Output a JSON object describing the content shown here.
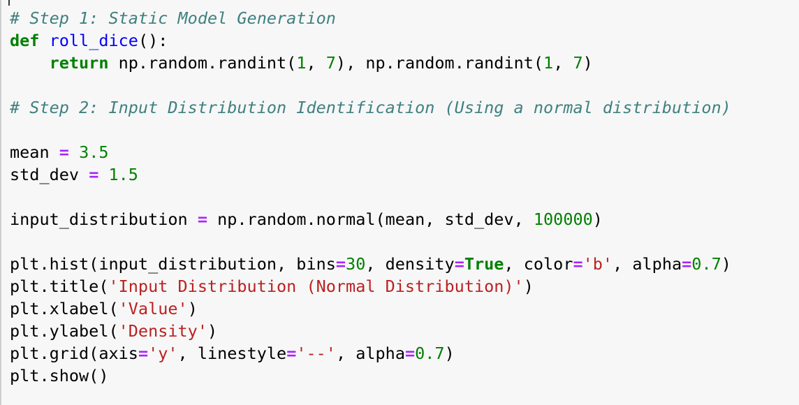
{
  "code": {
    "lines": [
      [
        {
          "t": "# Step 1: Static Model Generation",
          "k": "cm"
        }
      ],
      [
        {
          "t": "def",
          "k": "kw"
        },
        {
          "t": " "
        },
        {
          "t": "roll_dice",
          "k": "fn"
        },
        {
          "t": "():"
        }
      ],
      [
        {
          "t": "    "
        },
        {
          "t": "return",
          "k": "kw"
        },
        {
          "t": " np.random.randint("
        },
        {
          "t": "1",
          "k": "num"
        },
        {
          "t": ", "
        },
        {
          "t": "7",
          "k": "num"
        },
        {
          "t": "), np.random.randint("
        },
        {
          "t": "1",
          "k": "num"
        },
        {
          "t": ", "
        },
        {
          "t": "7",
          "k": "num"
        },
        {
          "t": ")"
        }
      ],
      [],
      [
        {
          "t": "# Step 2: Input Distribution Identification (Using a normal distribution)",
          "k": "cm"
        }
      ],
      [],
      [
        {
          "t": "mean "
        },
        {
          "t": "=",
          "k": "op"
        },
        {
          "t": " "
        },
        {
          "t": "3.5",
          "k": "num"
        }
      ],
      [
        {
          "t": "std_dev "
        },
        {
          "t": "=",
          "k": "op"
        },
        {
          "t": " "
        },
        {
          "t": "1.5",
          "k": "num"
        }
      ],
      [],
      [
        {
          "t": "input_distribution "
        },
        {
          "t": "=",
          "k": "op"
        },
        {
          "t": " np.random.normal(mean, std_dev, "
        },
        {
          "t": "100000",
          "k": "num"
        },
        {
          "t": ")"
        }
      ],
      [],
      [
        {
          "t": "plt.hist(input_distribution, bins"
        },
        {
          "t": "=",
          "k": "op"
        },
        {
          "t": "30",
          "k": "num"
        },
        {
          "t": ", density"
        },
        {
          "t": "=",
          "k": "op"
        },
        {
          "t": "True",
          "k": "bool"
        },
        {
          "t": ", color"
        },
        {
          "t": "=",
          "k": "op"
        },
        {
          "t": "'b'",
          "k": "str"
        },
        {
          "t": ", alpha"
        },
        {
          "t": "=",
          "k": "op"
        },
        {
          "t": "0.7",
          "k": "num"
        },
        {
          "t": ")"
        }
      ],
      [
        {
          "t": "plt.title("
        },
        {
          "t": "'Input Distribution (Normal Distribution)'",
          "k": "str"
        },
        {
          "t": ")"
        }
      ],
      [
        {
          "t": "plt.xlabel("
        },
        {
          "t": "'Value'",
          "k": "str"
        },
        {
          "t": ")"
        }
      ],
      [
        {
          "t": "plt.ylabel("
        },
        {
          "t": "'Density'",
          "k": "str"
        },
        {
          "t": ")"
        }
      ],
      [
        {
          "t": "plt.grid(axis"
        },
        {
          "t": "=",
          "k": "op"
        },
        {
          "t": "'y'",
          "k": "str"
        },
        {
          "t": ", linestyle"
        },
        {
          "t": "=",
          "k": "op"
        },
        {
          "t": "'--'",
          "k": "str"
        },
        {
          "t": ", alpha"
        },
        {
          "t": "=",
          "k": "op"
        },
        {
          "t": "0.7",
          "k": "num"
        },
        {
          "t": ")"
        }
      ],
      [
        {
          "t": "plt.show()"
        }
      ]
    ]
  },
  "colors": {
    "cell_background": "#f7f7f7",
    "comment": "#408080",
    "keyword": "#008000",
    "function_name": "#0000ff",
    "operator": "#aa22ff",
    "number": "#008000",
    "string": "#ba2121"
  }
}
